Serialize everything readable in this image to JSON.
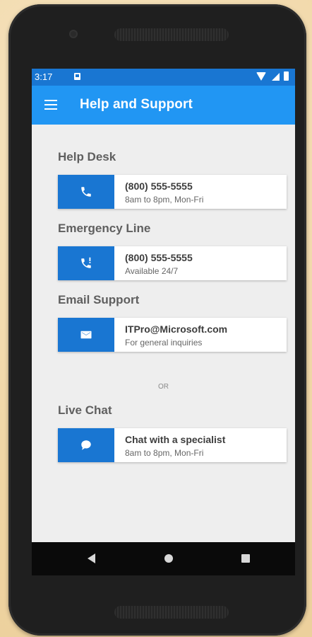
{
  "status_bar": {
    "time": "3:17"
  },
  "app_bar": {
    "title": "Help and Support"
  },
  "sections": [
    {
      "title": "Help Desk",
      "icon": "phone-icon",
      "primary": "(800) 555-5555",
      "secondary": "8am to 8pm, Mon-Fri"
    },
    {
      "title": "Emergency Line",
      "icon": "phone-alert-icon",
      "primary": "(800) 555-5555",
      "secondary": "Available 24/7"
    },
    {
      "title": "Email Support",
      "icon": "mail-icon",
      "primary": "ITPro@Microsoft.com",
      "secondary": "For general inquiries"
    },
    {
      "title": "Live Chat",
      "icon": "chat-bubble-icon",
      "primary": "Chat with a specialist",
      "secondary": "8am to 8pm, Mon-Fri"
    }
  ],
  "divider_text": "OR",
  "nav_bar": {
    "back_icon": "back-triangle-icon",
    "home_icon": "home-circle-icon",
    "recent_icon": "recent-apps-square-icon"
  },
  "colors": {
    "app_bar": "#2196f3",
    "status_bar": "#1976d2",
    "icon_tile": "#1976d2",
    "screen_bg": "#eeeeee",
    "section_title": "#5f5f5f"
  }
}
